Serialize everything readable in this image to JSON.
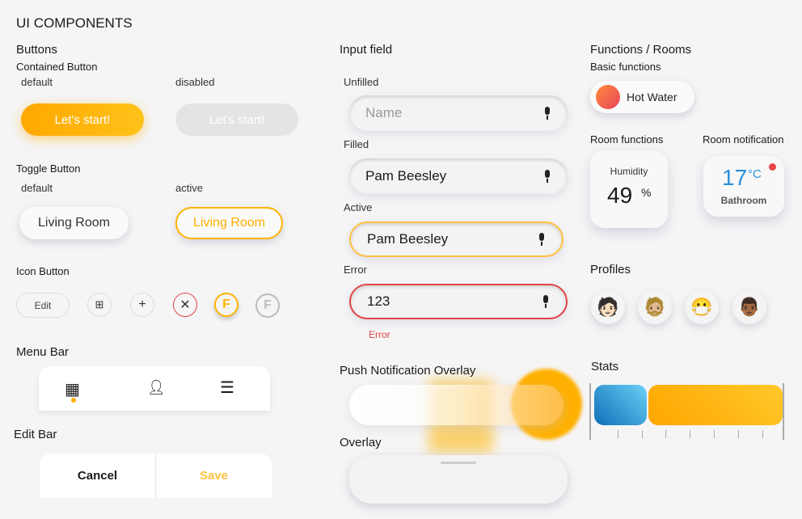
{
  "title": "UI COMPONENTS",
  "buttons": {
    "heading": "Buttons",
    "contained": "Contained Button",
    "default": "default",
    "disabled": "disabled",
    "label": "Let's start!"
  },
  "toggle": {
    "heading": "Toggle Button",
    "default": "default",
    "active": "active",
    "label": "Living Room"
  },
  "icon_button": {
    "heading": "Icon Button",
    "edit": "Edit",
    "f": "F"
  },
  "menu_bar": {
    "heading": "Menu Bar"
  },
  "edit_bar": {
    "heading": "Edit Bar",
    "cancel": "Cancel",
    "save": "Save"
  },
  "input": {
    "heading": "Input field",
    "unfilled": "Unfilled",
    "placeholder": "Name",
    "filled": "Filled",
    "value": "Pam Beesley",
    "active": "Active",
    "error_label": "Error",
    "error_value": "123",
    "error_msg": "Error"
  },
  "push": {
    "heading": "Push Notification Overlay"
  },
  "overlay": {
    "heading": "Overlay"
  },
  "functions": {
    "heading": "Functions / Rooms",
    "basic": "Basic functions",
    "hot_water": "Hot Water",
    "room_functions": "Room functions",
    "humidity_label": "Humidity",
    "humidity_value": "49",
    "humidity_unit": "%",
    "room_notification": "Room notification",
    "temp_value": "17",
    "temp_unit": "°C",
    "room": "Bathroom"
  },
  "profiles": {
    "heading": "Profiles"
  },
  "stats": {
    "heading": "Stats",
    "blue_fraction": 0.28,
    "colors": {
      "blue": "#1a7fc4",
      "orange": "#ffb010"
    }
  },
  "colors": {
    "accent": "#ffae00",
    "error": "#e04545",
    "temp": "#2a8fd8"
  }
}
